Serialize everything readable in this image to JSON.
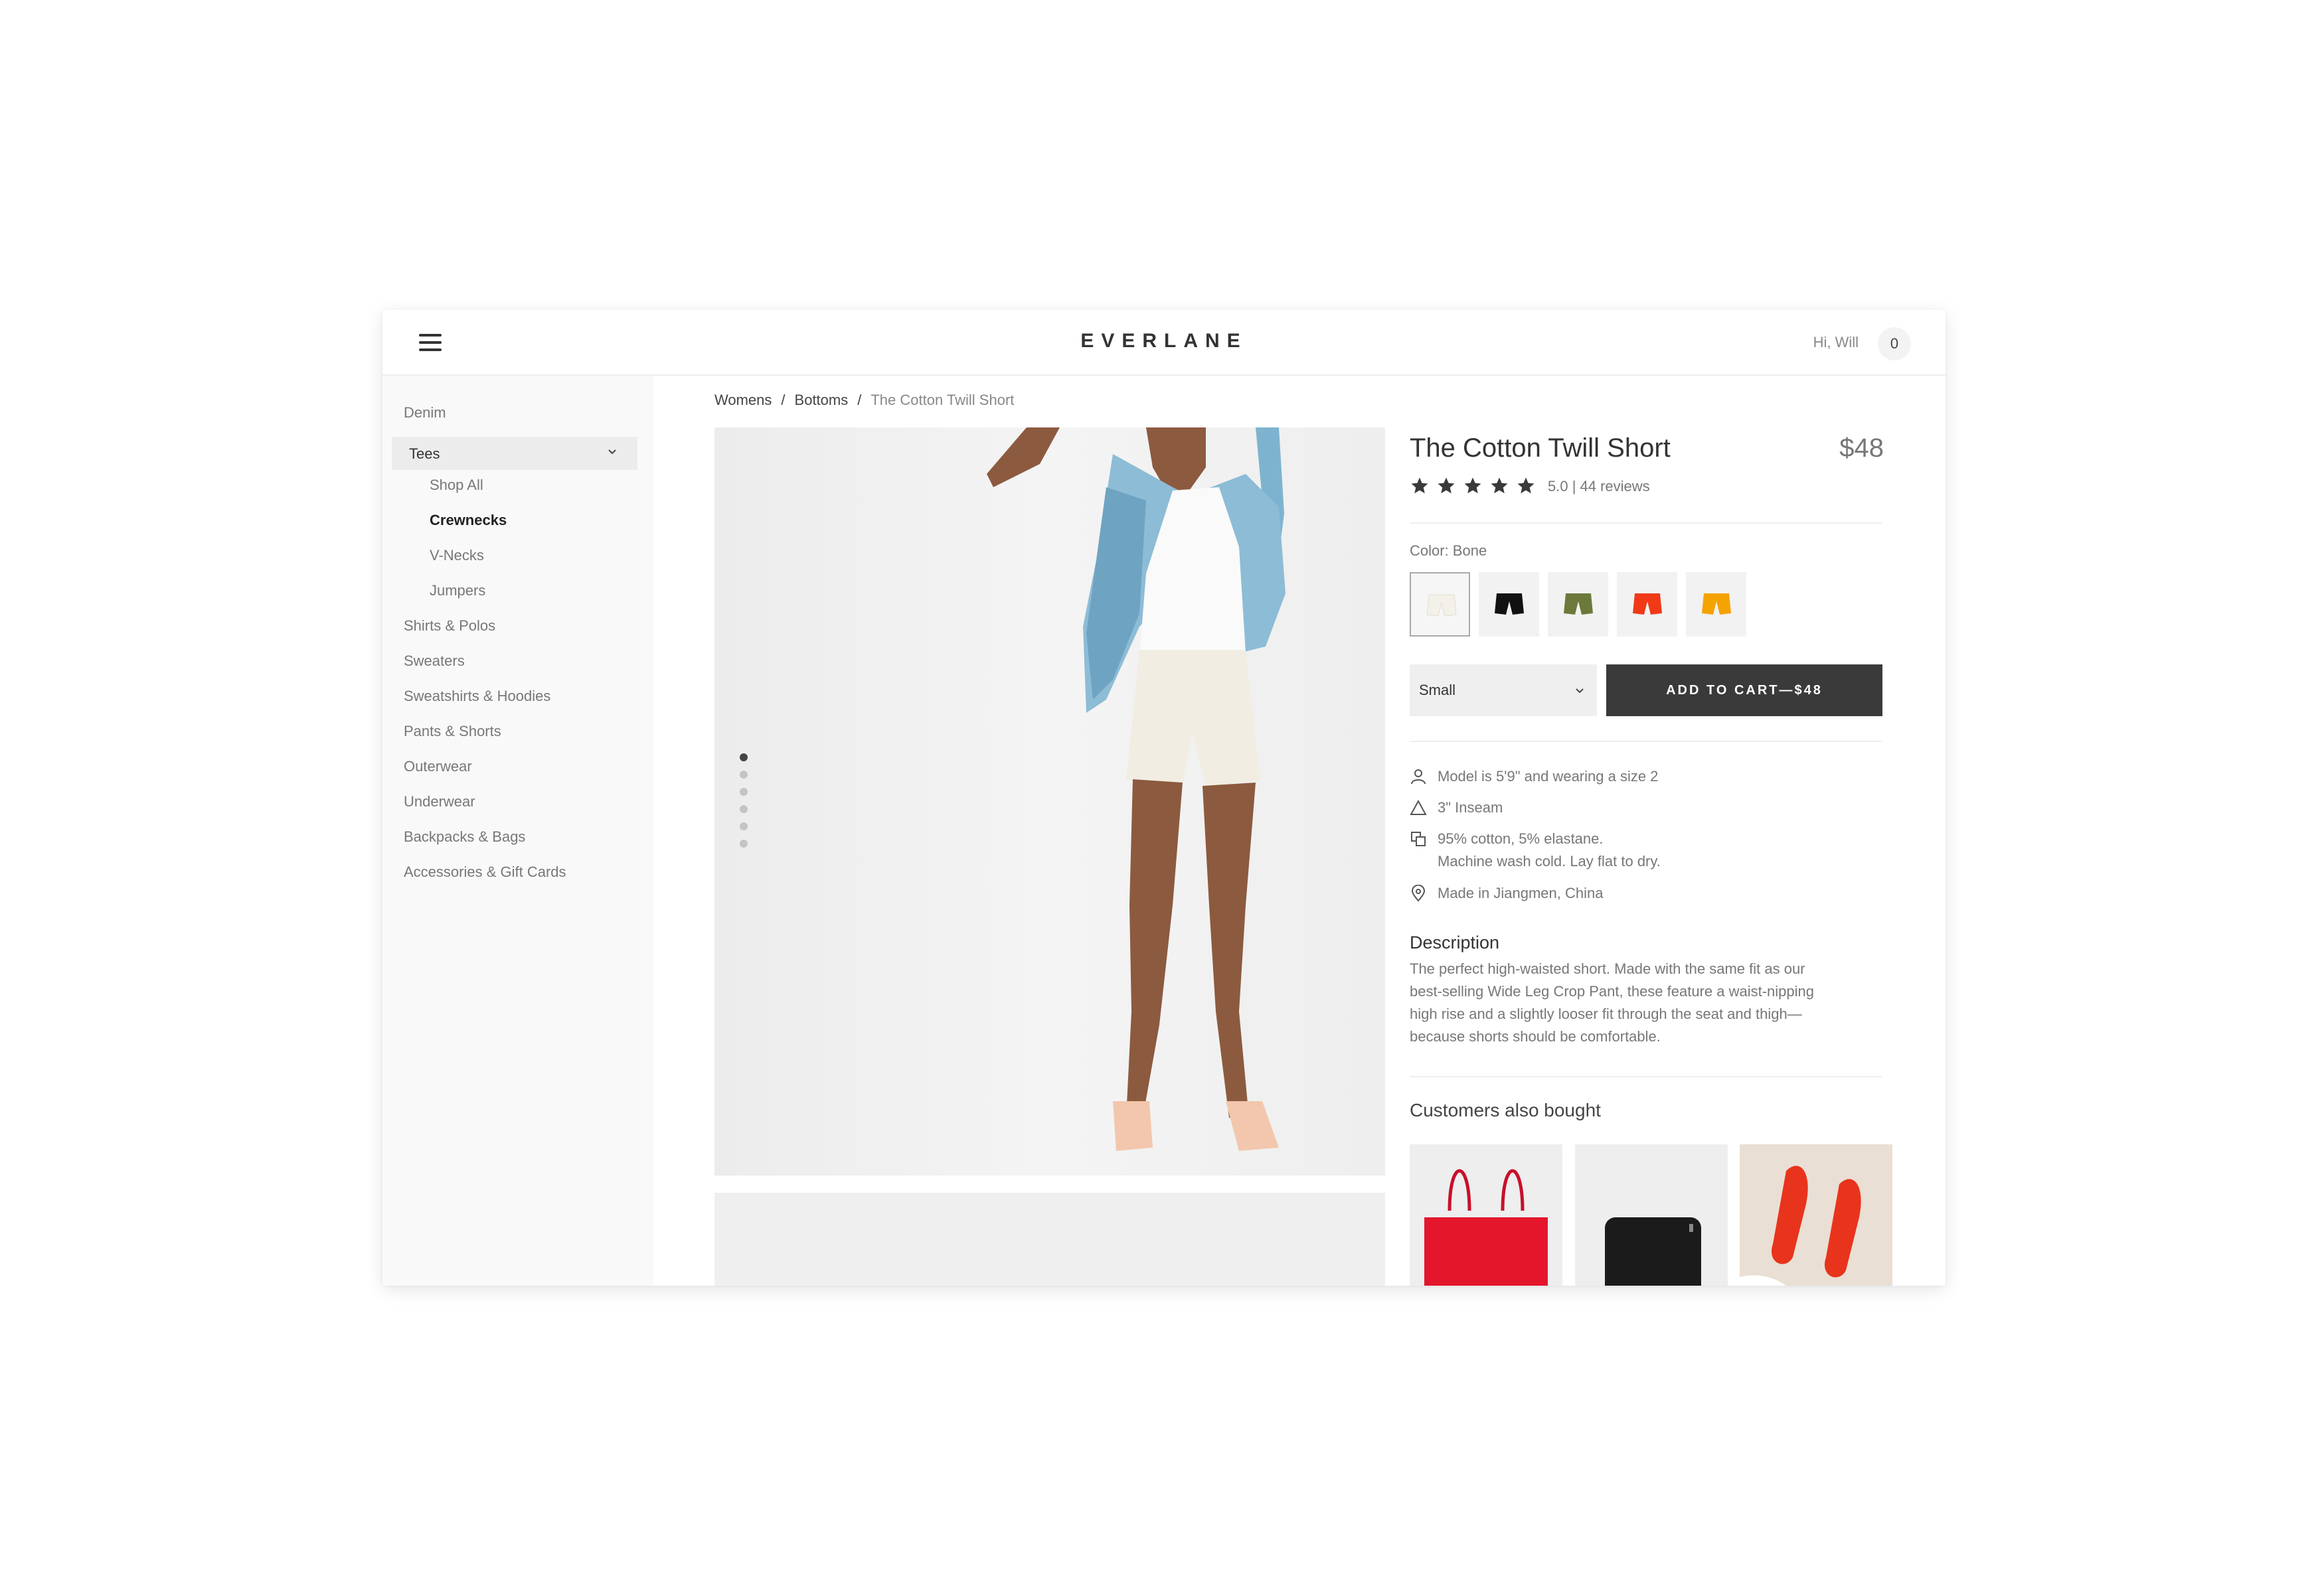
{
  "header": {
    "brand": "EVERLANE",
    "greeting": "Hi, Will",
    "cart_count": "0"
  },
  "sidebar": {
    "items": [
      {
        "label": "Denim"
      },
      {
        "label": "Tees"
      },
      {
        "label": "Shop All"
      },
      {
        "label": "Crewnecks"
      },
      {
        "label": "V-Necks"
      },
      {
        "label": "Jumpers"
      },
      {
        "label": "Shirts & Polos"
      },
      {
        "label": "Sweaters"
      },
      {
        "label": "Sweatshirts & Hoodies"
      },
      {
        "label": "Pants & Shorts"
      },
      {
        "label": "Outerwear"
      },
      {
        "label": "Underwear"
      },
      {
        "label": "Backpacks & Bags"
      },
      {
        "label": "Accessories & Gift Cards"
      }
    ],
    "expanded": "Tees",
    "selected": "Crewnecks"
  },
  "breadcrumb": {
    "items": [
      "Womens",
      "Bottoms",
      "The Cotton Twill Short"
    ],
    "separator": "/"
  },
  "gallery": {
    "slide_count": 6,
    "active_index": 0
  },
  "product": {
    "title": "The Cotton Twill Short",
    "price": "$48",
    "rating_stars": 5,
    "rating_text": "5.0 | 44 reviews",
    "color_label": "Color: Bone",
    "swatches": [
      {
        "name": "Bone",
        "color": "#f4f1ea",
        "selected": true
      },
      {
        "name": "Black",
        "color": "#111111",
        "selected": false
      },
      {
        "name": "Olive",
        "color": "#6b7a3a",
        "selected": false
      },
      {
        "name": "Red",
        "color": "#f03a17",
        "selected": false
      },
      {
        "name": "Yellow",
        "color": "#f5a300",
        "selected": false
      }
    ],
    "size_value": "Small",
    "add_to_cart": "ADD TO CART—$48",
    "facts": [
      {
        "icon": "person-icon",
        "lines": [
          "Model is 5'9\" and wearing a size 2"
        ]
      },
      {
        "icon": "triangle-ruler-icon",
        "lines": [
          "3\" Inseam"
        ]
      },
      {
        "icon": "fabric-icon",
        "lines": [
          "95% cotton, 5% elastane.",
          "Machine wash cold. Lay flat to dry."
        ]
      },
      {
        "icon": "location-pin-icon",
        "lines": [
          "Made in Jiangmen, China"
        ]
      }
    ],
    "description_title": "Description",
    "description_lines": [
      "The perfect high-waisted short. Made with the same fit as our",
      "best-selling Wide Leg Crop Pant, these feature a waist-nipping",
      "high rise and a slightly looser fit through the seat and thigh—",
      "because shorts should be comfortable."
    ]
  },
  "also_bought": {
    "title": "Customers also bought",
    "items": [
      {
        "name": "red-tote-bag",
        "color": "#e4162c"
      },
      {
        "name": "black-wallet",
        "color": "#1b1b1b"
      },
      {
        "name": "red-flats",
        "color": "#e8341c"
      }
    ]
  },
  "colors": {
    "accent": "#3a3a3a",
    "text": "#333333",
    "muted": "#777777",
    "sidebar_bg": "#f9f9f9"
  }
}
